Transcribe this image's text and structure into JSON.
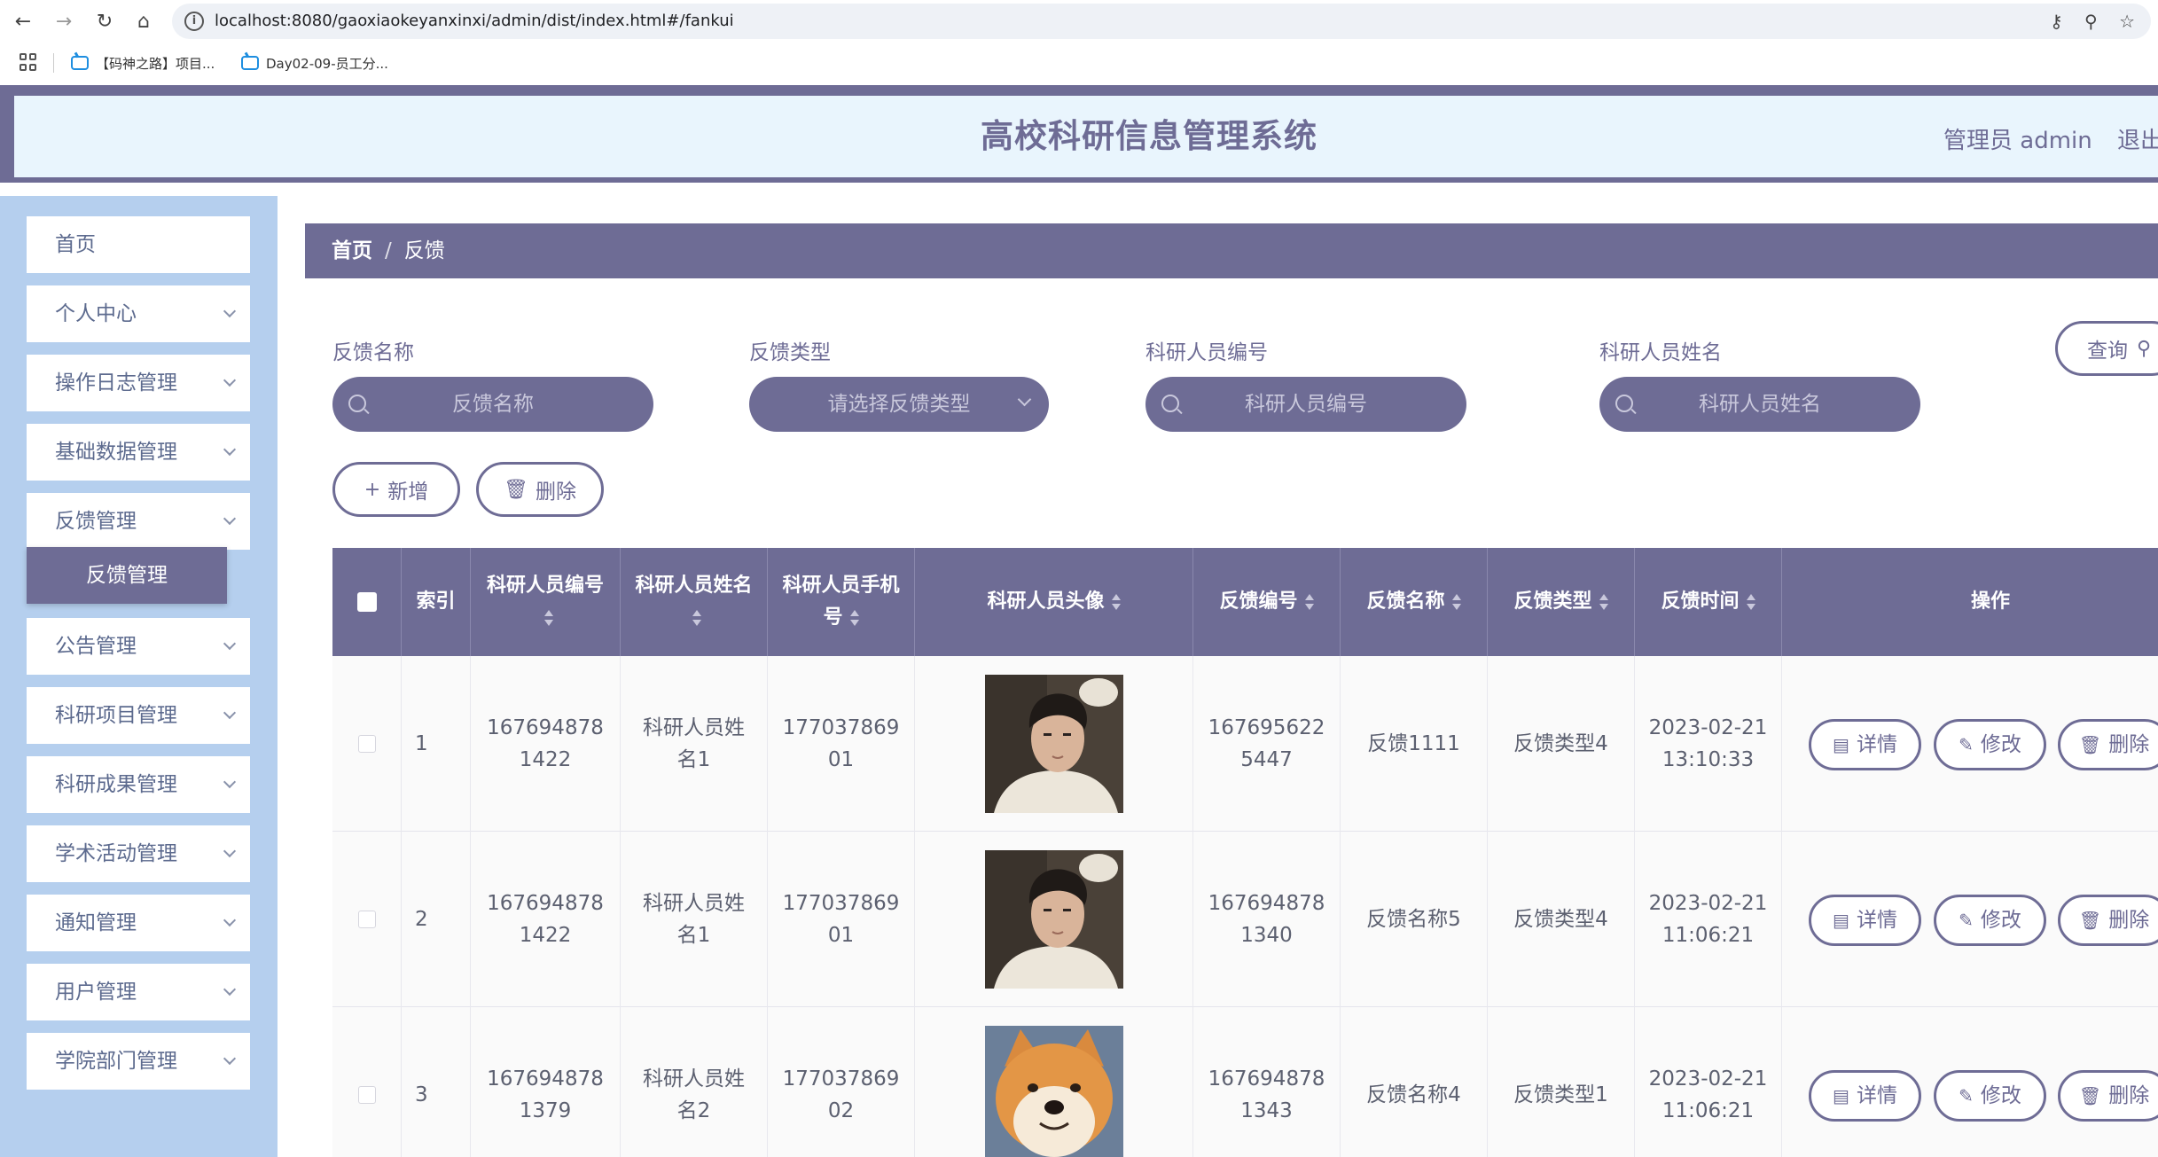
{
  "browser": {
    "url": "localhost:8080/gaoxiaokeyanxinxi/admin/dist/index.html#/fankui",
    "bookmarks": [
      "【码神之路】项目...",
      "Day02-09-员工分..."
    ]
  },
  "header": {
    "title": "高校科研信息管理系统",
    "user": "管理员 admin",
    "logout": "退出"
  },
  "sidebar": {
    "items": [
      {
        "label": "首页"
      },
      {
        "label": "个人中心"
      },
      {
        "label": "操作日志管理"
      },
      {
        "label": "基础数据管理"
      },
      {
        "label": "反馈管理"
      },
      {
        "label": "公告管理"
      },
      {
        "label": "科研项目管理"
      },
      {
        "label": "科研成果管理"
      },
      {
        "label": "学术活动管理"
      },
      {
        "label": "通知管理"
      },
      {
        "label": "用户管理"
      },
      {
        "label": "学院部门管理"
      }
    ],
    "active_sub": "反馈管理"
  },
  "breadcrumb": {
    "home": "首页",
    "current": "反馈"
  },
  "search": {
    "fields": [
      {
        "label": "反馈名称",
        "placeholder": "反馈名称"
      },
      {
        "label": "反馈类型",
        "placeholder": "请选择反馈类型"
      },
      {
        "label": "科研人员编号",
        "placeholder": "科研人员编号"
      },
      {
        "label": "科研人员姓名",
        "placeholder": "科研人员姓名"
      }
    ],
    "query_label": "查询"
  },
  "toolbar": {
    "add_label": "新增",
    "delete_label": "删除"
  },
  "table": {
    "headers": {
      "index": "索引",
      "staff_no": "科研人员编号",
      "staff_name": "科研人员姓名",
      "staff_phone": "科研人员手机号",
      "avatar": "科研人员头像",
      "fb_no": "反馈编号",
      "fb_name": "反馈名称",
      "fb_type": "反馈类型",
      "fb_time": "反馈时间",
      "actions": "操作"
    },
    "actions": {
      "detail": "详情",
      "edit": "修改",
      "delete": "删除"
    },
    "rows": [
      {
        "index": "1",
        "staff_no": "1676948781422",
        "staff_name": "科研人员姓名1",
        "staff_phone": "17703786901",
        "avatar": "young-man-photo",
        "fb_no": "1676956225447",
        "fb_name": "反馈1111",
        "fb_type": "反馈类型4",
        "fb_date": "2023-02-21",
        "fb_clock": "13:10:33"
      },
      {
        "index": "2",
        "staff_no": "1676948781422",
        "staff_name": "科研人员姓名1",
        "staff_phone": "17703786901",
        "avatar": "young-man-photo",
        "fb_no": "1676948781340",
        "fb_name": "反馈名称5",
        "fb_type": "反馈类型4",
        "fb_date": "2023-02-21",
        "fb_clock": "11:06:21"
      },
      {
        "index": "3",
        "staff_no": "1676948781379",
        "staff_name": "科研人员姓名2",
        "staff_phone": "17703786902",
        "avatar": "shiba-dog-photo",
        "fb_no": "1676948781343",
        "fb_name": "反馈名称4",
        "fb_type": "反馈类型1",
        "fb_date": "2023-02-21",
        "fb_clock": "11:06:21"
      }
    ]
  },
  "colors": {
    "primary": "#6e6c95",
    "sidebar_bg": "#b5cfee",
    "header_bg": "#e9f5fd"
  }
}
